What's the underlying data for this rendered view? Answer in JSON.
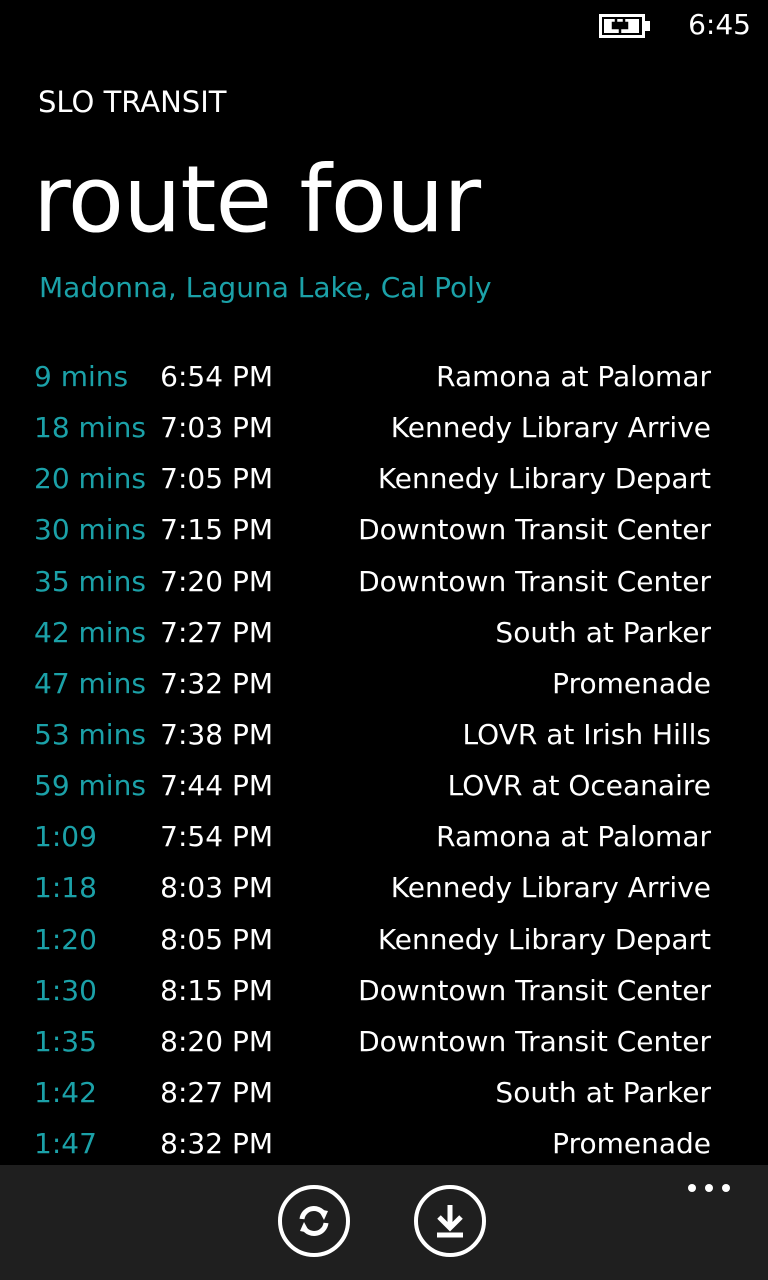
{
  "status": {
    "time": "6:45",
    "battery_icon": "battery-charging-icon"
  },
  "app_title": "SLO TRANSIT",
  "page_title": "route four",
  "subtitle": "Madonna, Laguna Lake, Cal Poly",
  "colors": {
    "accent": "#1ba1a8",
    "background": "#000000",
    "app_bar": "#1f1f1f"
  },
  "schedule": [
    {
      "eta": "9 mins",
      "time": "6:54 PM",
      "stop": "Ramona at Palomar"
    },
    {
      "eta": "18 mins",
      "time": "7:03 PM",
      "stop": "Kennedy Library Arrive"
    },
    {
      "eta": "20 mins",
      "time": "7:05 PM",
      "stop": "Kennedy Library Depart"
    },
    {
      "eta": "30 mins",
      "time": "7:15 PM",
      "stop": "Downtown Transit Center"
    },
    {
      "eta": "35 mins",
      "time": "7:20 PM",
      "stop": "Downtown Transit Center"
    },
    {
      "eta": "42 mins",
      "time": "7:27 PM",
      "stop": "South at Parker"
    },
    {
      "eta": "47 mins",
      "time": "7:32 PM",
      "stop": "Promenade"
    },
    {
      "eta": "53 mins",
      "time": "7:38 PM",
      "stop": "LOVR at Irish Hills"
    },
    {
      "eta": "59 mins",
      "time": "7:44 PM",
      "stop": "LOVR at Oceanaire"
    },
    {
      "eta": "1:09",
      "time": "7:54 PM",
      "stop": "Ramona at Palomar"
    },
    {
      "eta": "1:18",
      "time": "8:03 PM",
      "stop": "Kennedy Library Arrive"
    },
    {
      "eta": "1:20",
      "time": "8:05 PM",
      "stop": "Kennedy Library Depart"
    },
    {
      "eta": "1:30",
      "time": "8:15 PM",
      "stop": "Downtown Transit Center"
    },
    {
      "eta": "1:35",
      "time": "8:20 PM",
      "stop": "Downtown Transit Center"
    },
    {
      "eta": "1:42",
      "time": "8:27 PM",
      "stop": "South at Parker"
    },
    {
      "eta": "1:47",
      "time": "8:32 PM",
      "stop": "Promenade"
    }
  ],
  "app_bar": {
    "buttons": [
      {
        "icon": "refresh-icon"
      },
      {
        "icon": "download-icon"
      }
    ],
    "more_icon": "more-options-icon"
  }
}
